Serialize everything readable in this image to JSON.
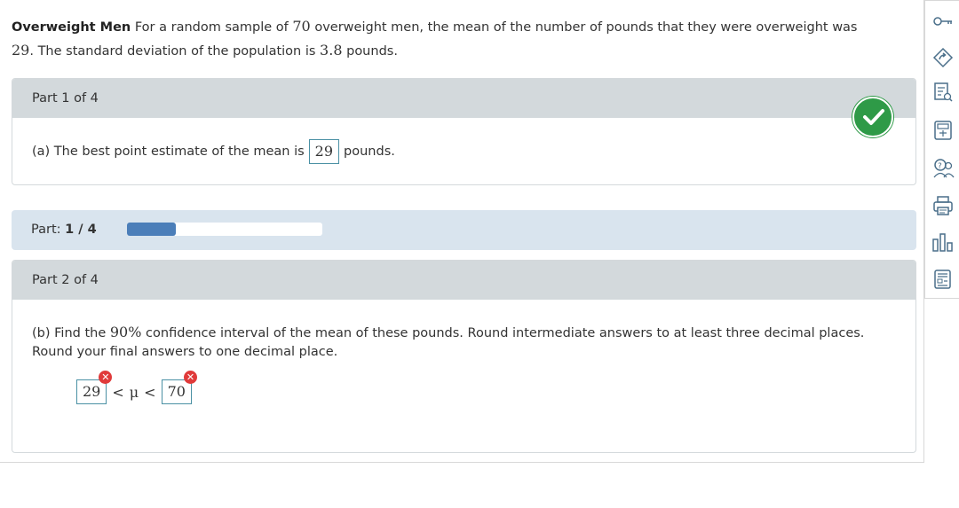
{
  "problem": {
    "title": "Overweight Men",
    "text_1": " For a random sample of ",
    "n": "70",
    "text_2": " overweight men, the mean of the number of pounds that they were overweight was",
    "mean": "29",
    "text_3": ". The standard deviation of the population is ",
    "sd": "3.8",
    "text_4": " pounds."
  },
  "part1": {
    "header": "Part 1 of 4",
    "prefix": "(a) The best point estimate of the mean is",
    "answer": "29",
    "suffix": "pounds.",
    "status_icon": "check-icon"
  },
  "progress": {
    "label": "Part:",
    "current": "1 / 4",
    "fraction": 0.25
  },
  "part2": {
    "header": "Part 2 of 4",
    "q_1": "(b) Find the ",
    "confidence": "90%",
    "q_2": " confidence interval of the mean of these pounds. Round intermediate answers to at least three decimal places. Round your final answers to one decimal place.",
    "lower": "29",
    "less_than_1": "<",
    "mu": "μ",
    "less_than_2": "<",
    "upper": "70",
    "error_mark": "✕"
  },
  "toolbar": {
    "icons": [
      "key-icon",
      "share-icon",
      "worksheet-icon",
      "calculator-icon",
      "help-icon",
      "print-icon",
      "chart-icon",
      "notes-icon"
    ]
  },
  "colors": {
    "header_bg": "#d3d9dc",
    "progress_bg": "#d9e4ee",
    "progress_fill": "#4b7eb9",
    "correct": "#2e9a47",
    "incorrect": "#e03a3a",
    "answer_border": "#4a90a4"
  }
}
